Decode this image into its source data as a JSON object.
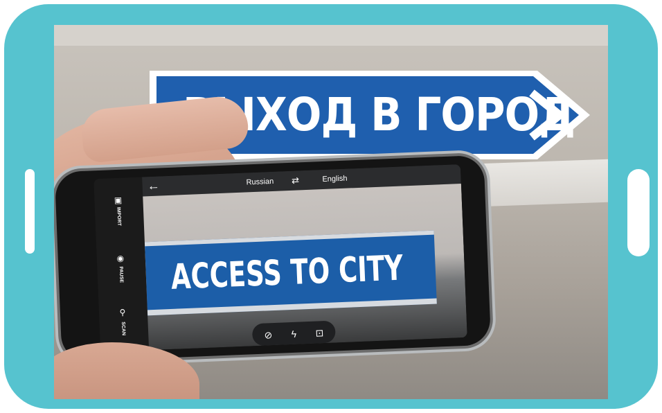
{
  "sign": {
    "text": "ВЫХОД В ГОРОД"
  },
  "app": {
    "top_bar": {
      "back_icon": "←",
      "source_language": "Russian",
      "swap_icon": "⇄",
      "target_language": "English"
    },
    "translation": "ACCESS TO CITY",
    "side_tools": [
      {
        "label": "IMPORT",
        "icon": "▣"
      },
      {
        "label": "PAUSE",
        "icon": "◉"
      },
      {
        "label": "SCAN",
        "icon": "⚲"
      }
    ],
    "bottom_controls": [
      {
        "name": "hide-translation-icon",
        "glyph": "⊘"
      },
      {
        "name": "flash-off-icon",
        "glyph": "ϟ"
      },
      {
        "name": "focus-icon",
        "glyph": "⊡"
      }
    ]
  },
  "colors": {
    "frame": "#56c3cf",
    "sign_blue": "#1f5fae",
    "app_bar": "#2b2c2e"
  }
}
